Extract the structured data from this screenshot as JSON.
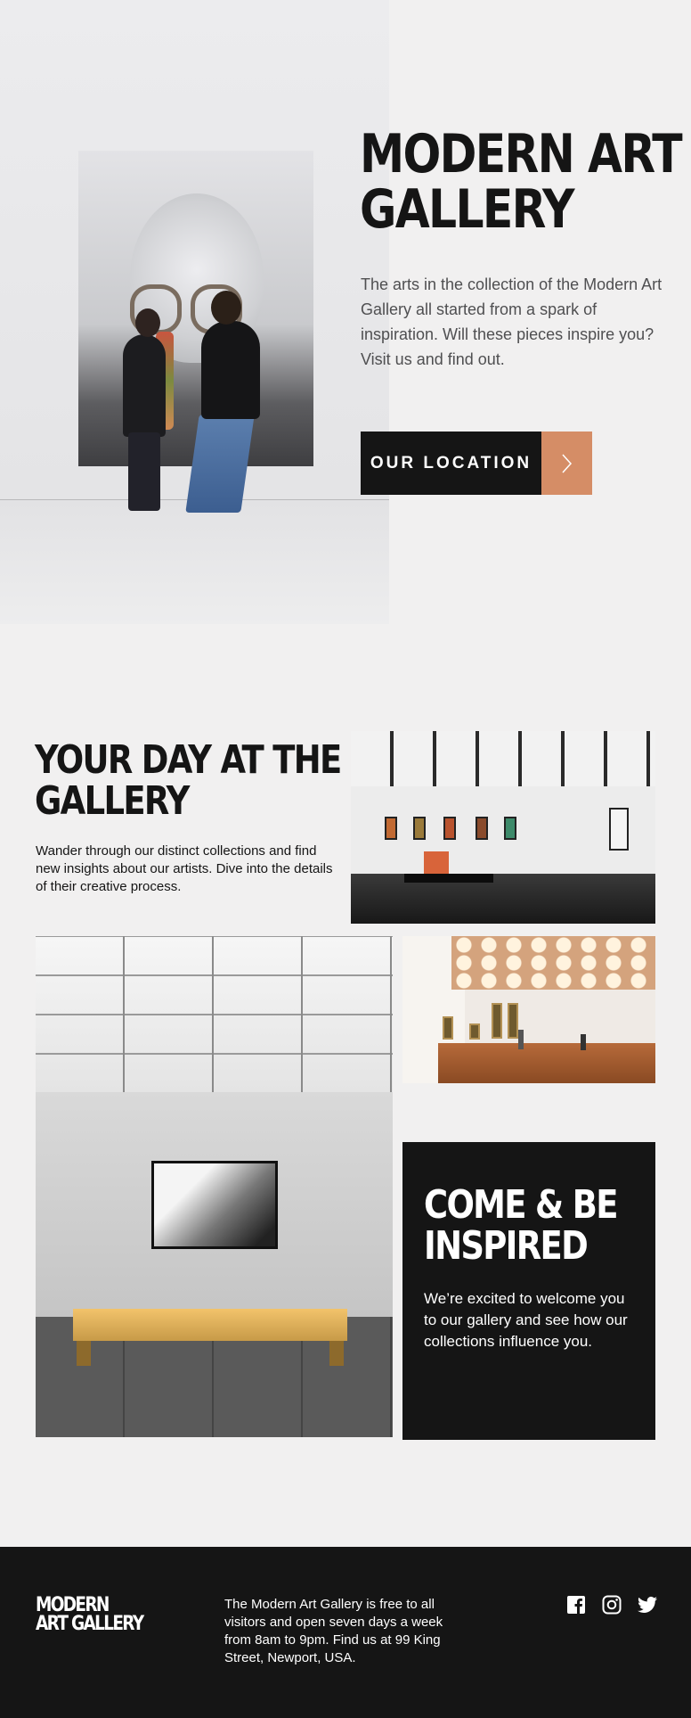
{
  "hero": {
    "title_line1": "MODERN ART",
    "title_line2": "GALLERY",
    "description": "The arts in the collection of the Modern Art Gallery all started from a spark of inspiration. Will these pieces inspire you? Visit us and find out.",
    "cta_label": "OUR LOCATION",
    "cta_icon": "chevron-right-icon",
    "accent_color": "#d58d66"
  },
  "day": {
    "title_line1": "YOUR DAY AT THE",
    "title_line2": "GALLERY",
    "description": "Wander through our distinct collections and find new insights about our artists. Dive into the details of their creative process."
  },
  "inspire": {
    "title_line1": "COME & BE",
    "title_line2": "INSPIRED",
    "description": "We’re excited to welcome you to our gallery and see how our collections influence you."
  },
  "footer": {
    "logo_line1": "MODERN",
    "logo_line2": "ART GALLERY",
    "info": "The Modern Art Gallery is free to all visitors and open seven days a week from 8am to 9pm. Find us at 99 King Street, Newport, USA.",
    "social_icons": [
      "facebook-icon",
      "instagram-icon",
      "twitter-icon"
    ]
  },
  "colors": {
    "background": "#f1f0f0",
    "dark": "#151515",
    "text_muted": "#4f4f51"
  }
}
